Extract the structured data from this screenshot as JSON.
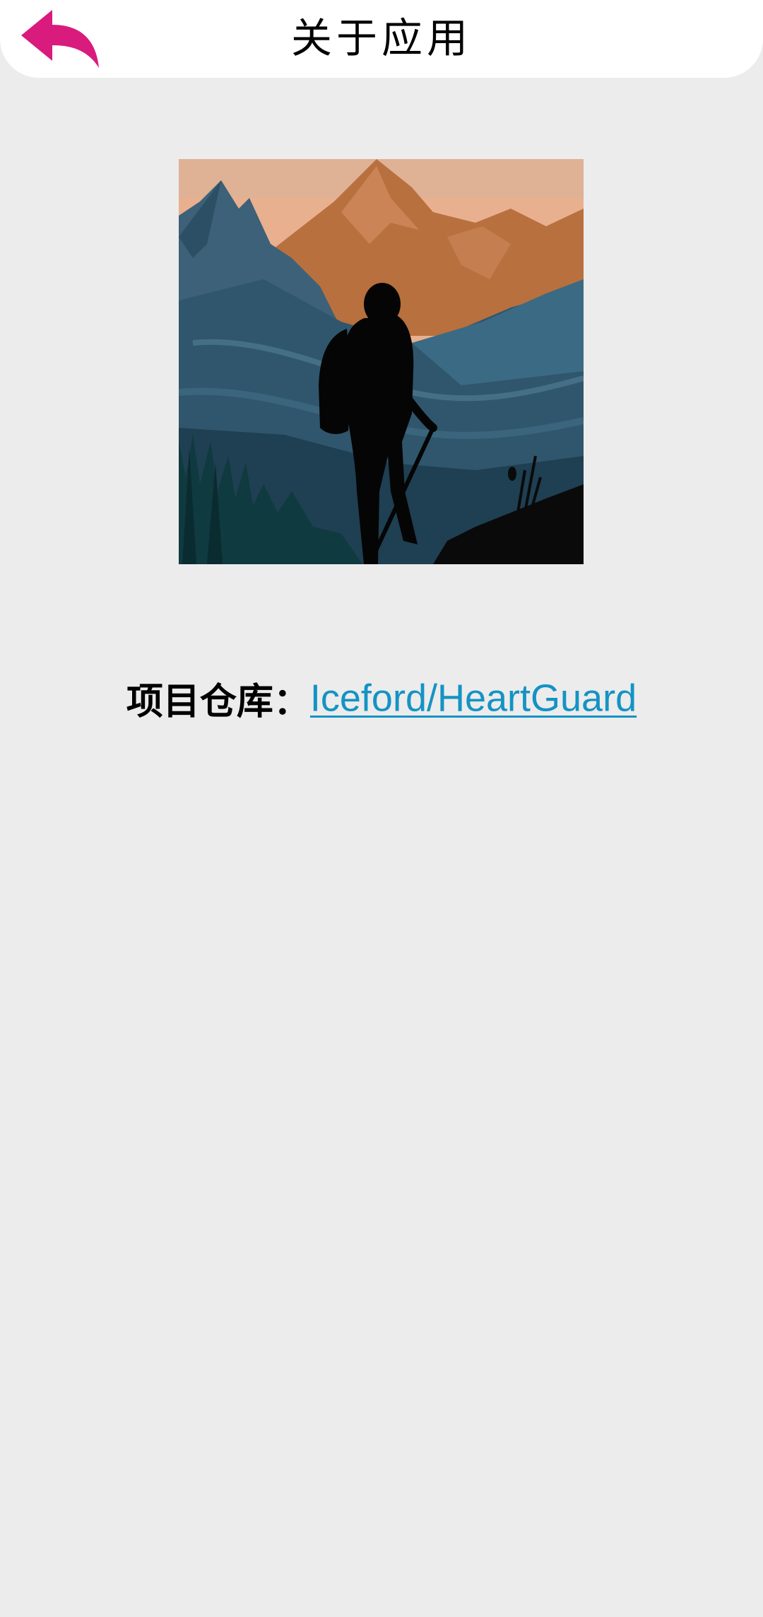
{
  "header": {
    "title": "关于应用",
    "back_icon": "reply-arrow-icon",
    "back_color": "#d81b7d"
  },
  "main": {
    "image_icon": "hiker-mountain-illustration",
    "repo_label": "项目仓库：",
    "repo_link_text": "Iceford/HeartGuard",
    "link_color": "#1493c4"
  }
}
